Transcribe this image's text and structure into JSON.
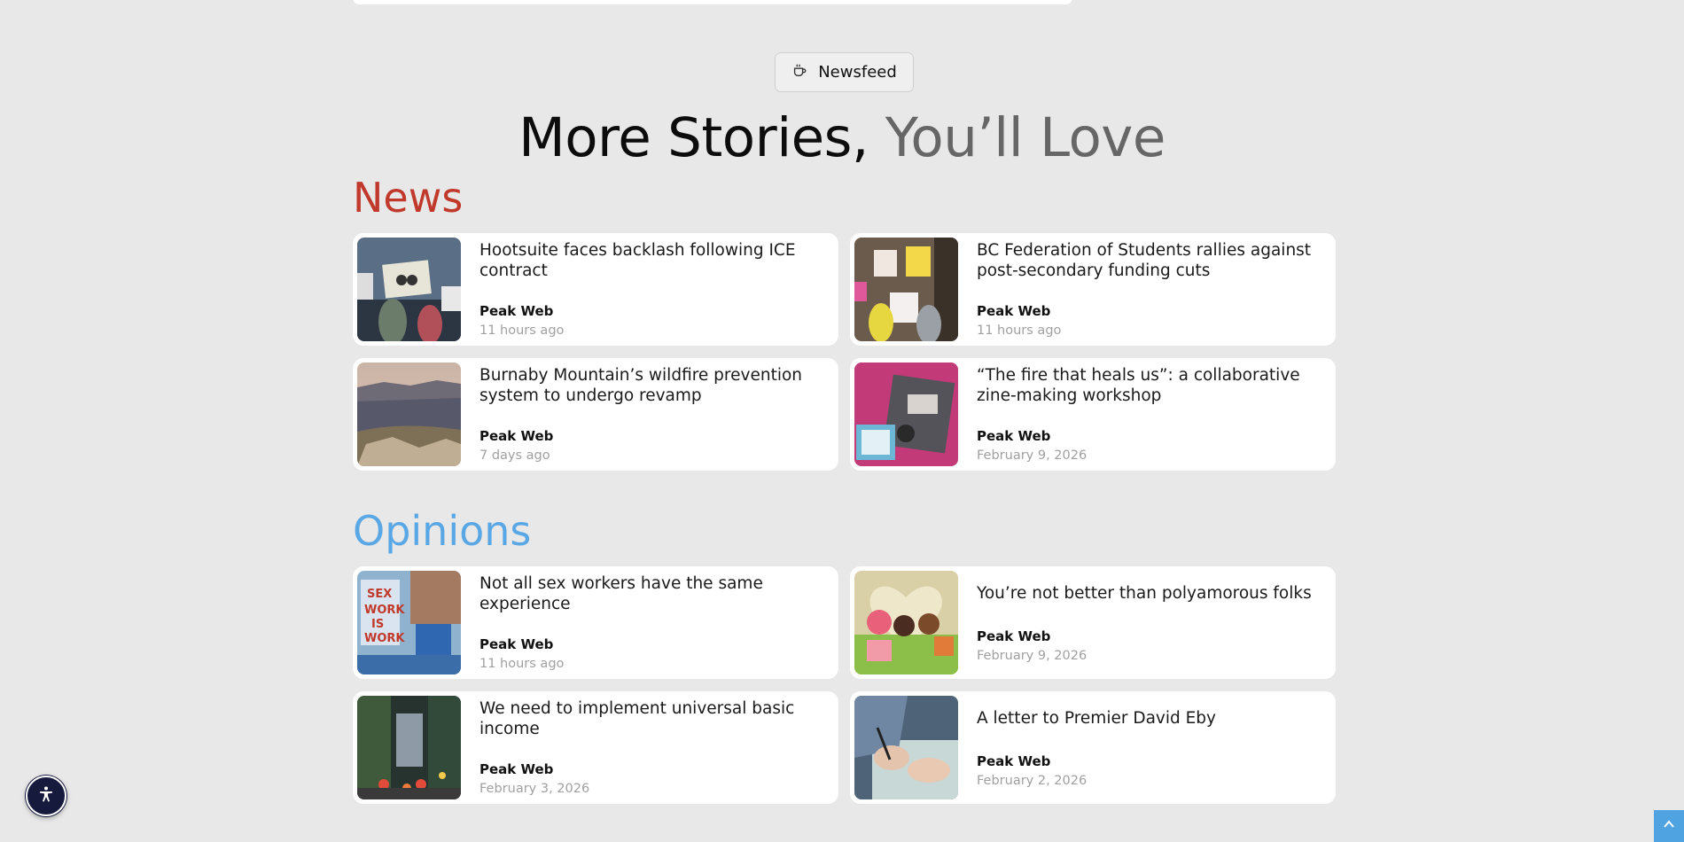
{
  "badge": {
    "label": "Newsfeed",
    "icon": "coffee-cup-icon"
  },
  "headline": {
    "part1": "More Stories,",
    "part2": "You’ll Love"
  },
  "sections": {
    "news": {
      "title": "News",
      "color": "#c0392b",
      "cards": [
        {
          "title": "Hootsuite faces backlash following ICE contract",
          "author": "Peak Web",
          "date": "11 hours ago"
        },
        {
          "title": "BC Federation of Students rallies against post-secondary funding cuts",
          "author": "Peak Web",
          "date": "11 hours ago"
        },
        {
          "title": "Burnaby Mountain’s wildfire prevention system to undergo revamp",
          "author": "Peak Web",
          "date": "7 days ago"
        },
        {
          "title": "“The fire that heals us”: a collaborative zine-making workshop",
          "author": "Peak Web",
          "date": "February 9, 2026"
        }
      ]
    },
    "opinions": {
      "title": "Opinions",
      "color": "#5aa7e6",
      "cards": [
        {
          "title": "Not all sex workers have the same experience",
          "author": "Peak Web",
          "date": "11 hours ago"
        },
        {
          "title": "You’re not better than polyamorous folks",
          "author": "Peak Web",
          "date": "February 9, 2026"
        },
        {
          "title": "We need to implement universal basic income",
          "author": "Peak Web",
          "date": "February 3, 2026"
        },
        {
          "title": "A letter to Premier David Eby",
          "author": "Peak Web",
          "date": "February 2, 2026"
        }
      ]
    }
  },
  "widgets": {
    "accessibility_icon": "accessibility-person-icon",
    "scroll_top_icon": "chevron-up-icon"
  },
  "colors": {
    "background": "#e8e8e8",
    "card": "#ffffff",
    "accessibility_button": "#161b3d",
    "scroll_top": "#4fa3e0"
  }
}
